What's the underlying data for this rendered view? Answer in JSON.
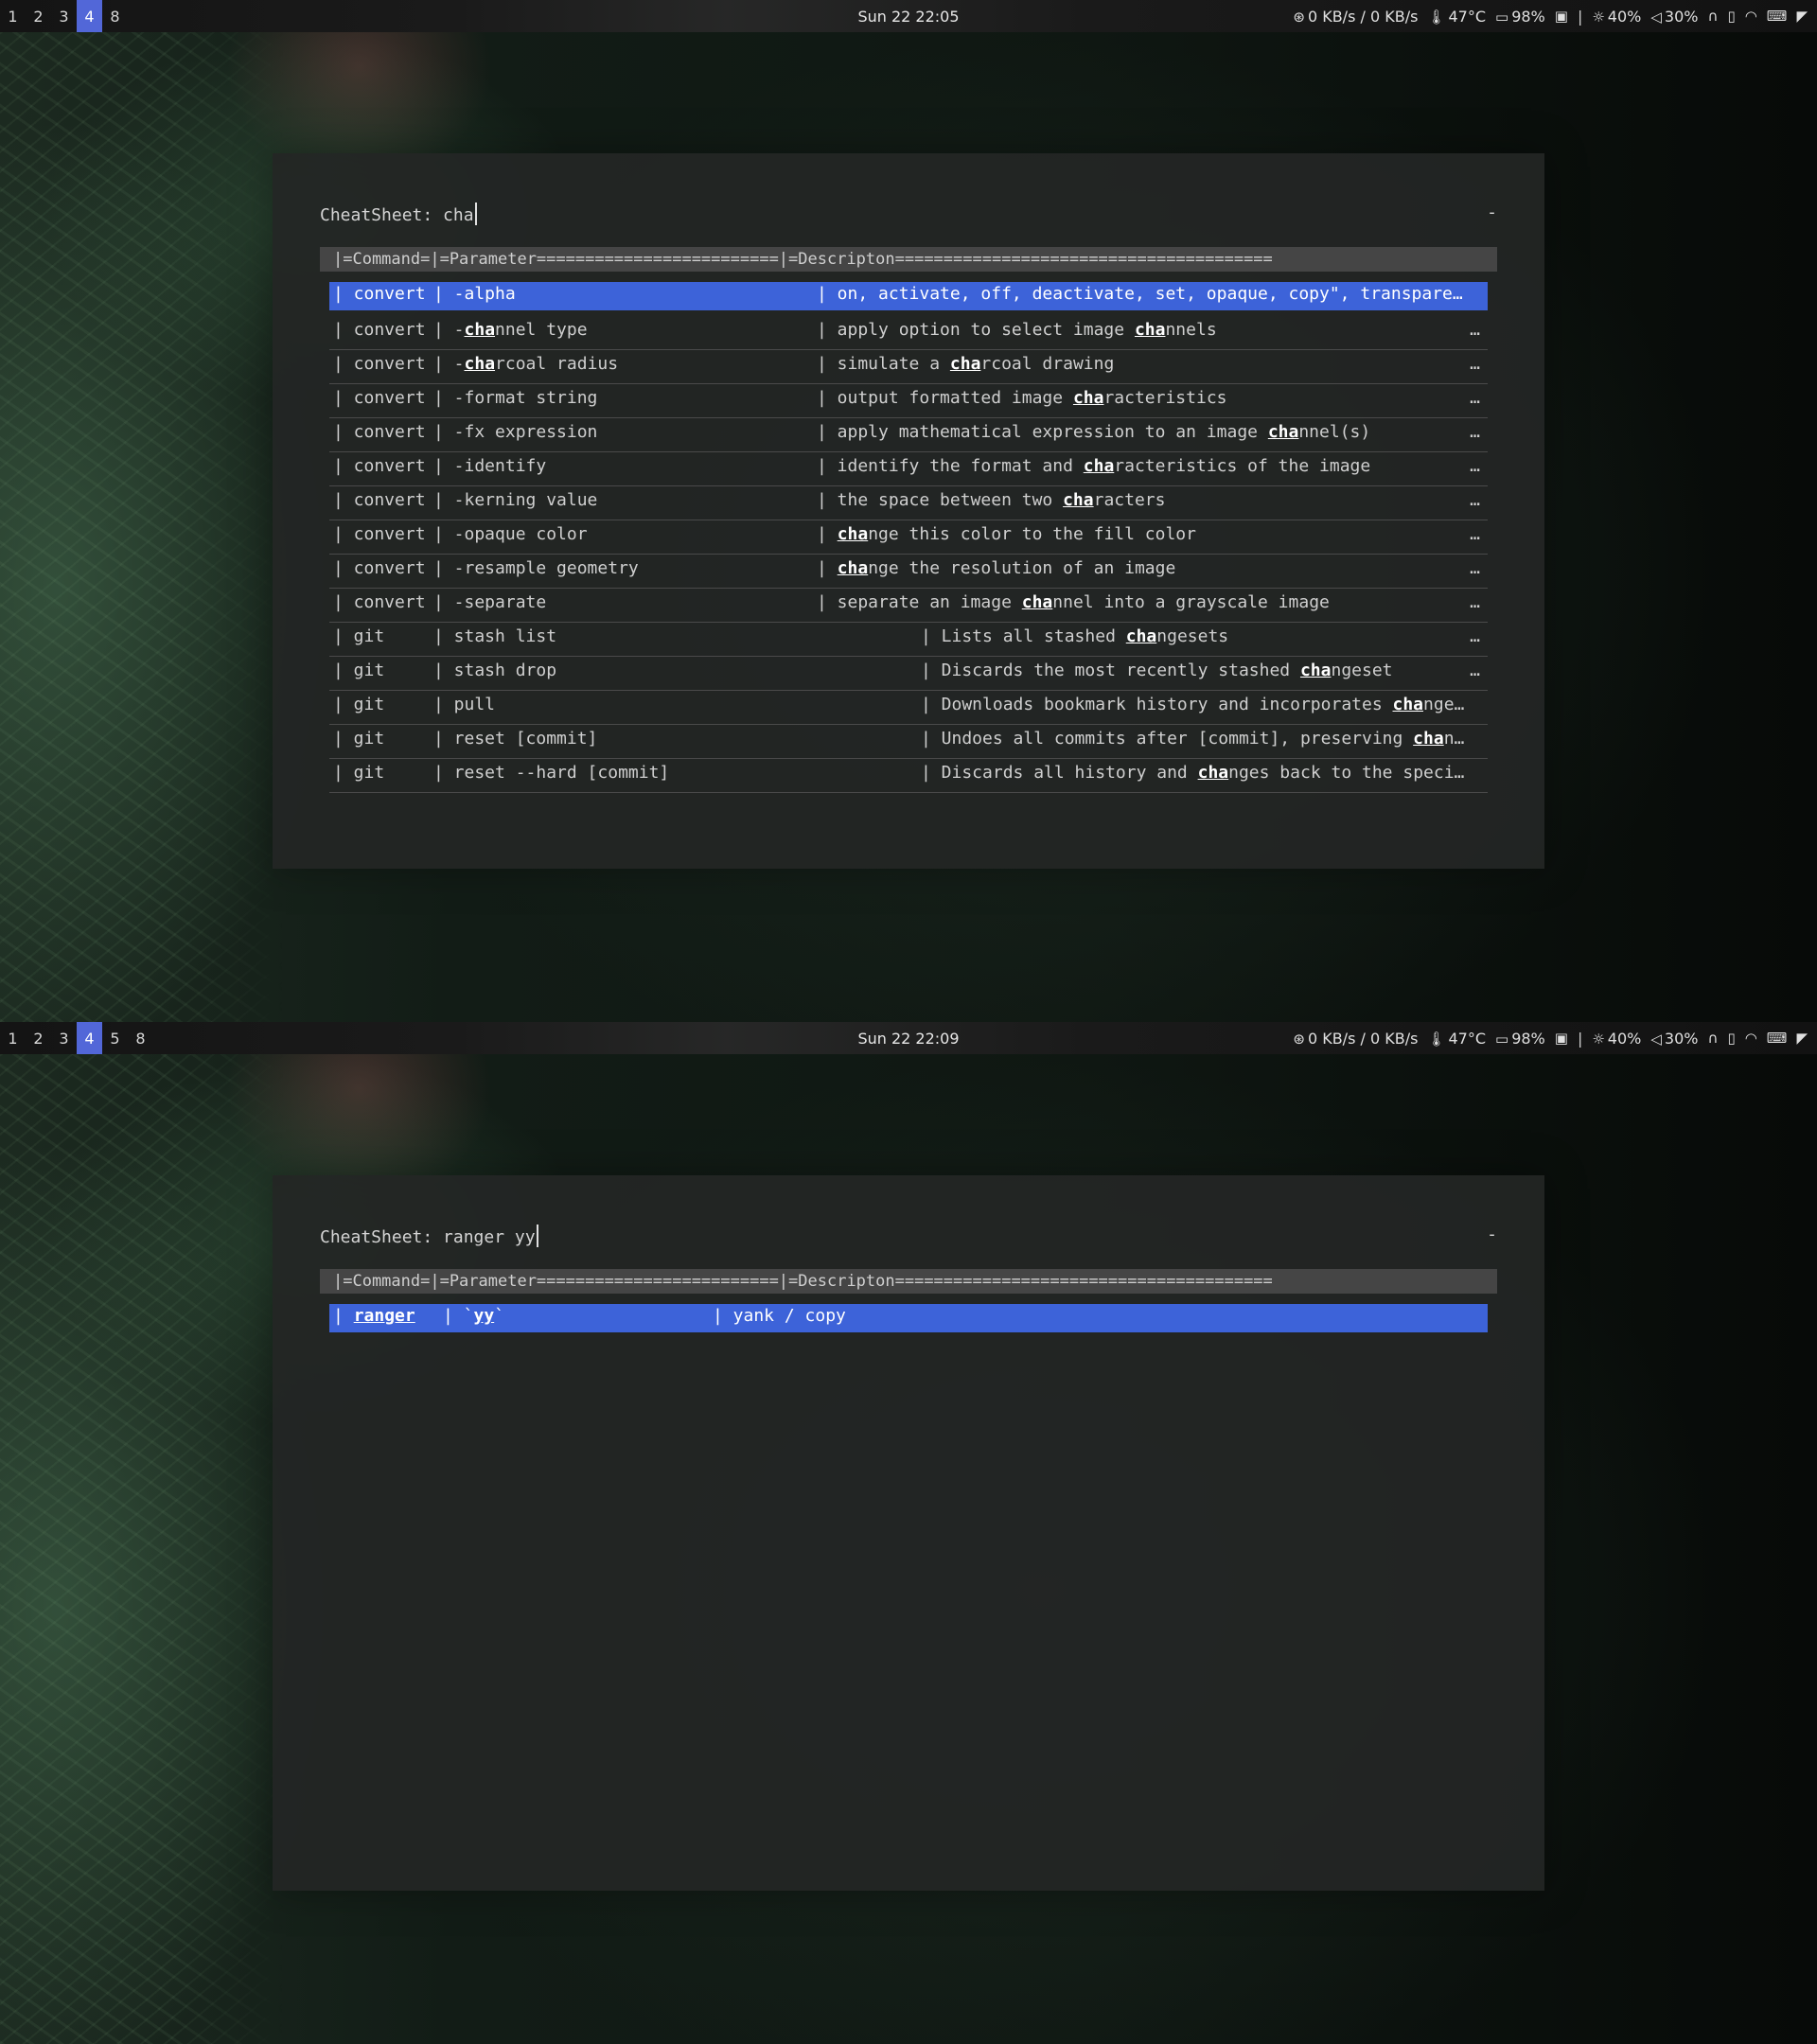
{
  "screens": [
    {
      "workspaces": [
        "1",
        "2",
        "3",
        "4",
        "8"
      ],
      "active_workspace": "4",
      "clock": "Sun 22 22:05",
      "status": {
        "net": "0 KB/s / 0 KB/s",
        "temp": "47°C",
        "battery": "98%",
        "separator": "|",
        "brightness": "40%",
        "volume": "30%"
      },
      "prompt_label": "CheatSheet: ",
      "query": "cha",
      "dash": "-",
      "header": "|=Command=|=Parameter=========================|=Descripton=======================================",
      "rows": [
        {
          "cmd": "| convert",
          "param": "| -alpha",
          "desc": "| on, activate, off, deactivate, set, opaque, copy\", transpare…",
          "selected": true
        },
        {
          "cmd": "| convert",
          "param": "| -channel type",
          "desc": "| apply option to select image channels",
          "ell": "…"
        },
        {
          "cmd": "| convert",
          "param": "| -charcoal radius",
          "desc": "| simulate a charcoal drawing",
          "ell": "…"
        },
        {
          "cmd": "| convert",
          "param": "| -format string",
          "desc": "| output formatted image characteristics",
          "ell": "…"
        },
        {
          "cmd": "| convert",
          "param": "| -fx expression",
          "desc": "| apply mathematical expression to an image channel(s)",
          "ell": "…"
        },
        {
          "cmd": "| convert",
          "param": "| -identify",
          "desc": "| identify the format and characteristics of the image",
          "ell": "…"
        },
        {
          "cmd": "| convert",
          "param": "| -kerning value",
          "desc": "| the space between two characters",
          "ell": "…"
        },
        {
          "cmd": "| convert",
          "param": "| -opaque color",
          "desc": "| change this color to the fill color",
          "ell": "…"
        },
        {
          "cmd": "| convert",
          "param": "| -resample geometry",
          "desc": "| change the resolution of an image",
          "ell": "…"
        },
        {
          "cmd": "| convert",
          "param": "| -separate",
          "desc": "| separate an image channel into a grayscale image",
          "ell": "…"
        },
        {
          "cmd": "| git",
          "param": "| stash list",
          "desc": "| Lists all stashed changesets",
          "ell": "…",
          "wide": true
        },
        {
          "cmd": "| git",
          "param": "| stash drop",
          "desc": "| Discards the most recently stashed changeset",
          "ell": "…",
          "wide": true
        },
        {
          "cmd": "| git",
          "param": "| pull",
          "desc": "| Downloads bookmark history and incorporates change…",
          "wide": true
        },
        {
          "cmd": "| git",
          "param": "| reset [commit]",
          "desc": "| Undoes all commits after [commit], preserving chan…",
          "wide": true
        },
        {
          "cmd": "| git",
          "param": "| reset --hard [commit]",
          "desc": "| Discards all history and changes back to the speci…",
          "wide": true
        }
      ]
    },
    {
      "workspaces": [
        "1",
        "2",
        "3",
        "4",
        "5",
        "8"
      ],
      "active_workspace": "4",
      "clock": "Sun 22 22:09",
      "status": {
        "net": "0 KB/s / 0 KB/s",
        "temp": "47°C",
        "battery": "98%",
        "separator": "|",
        "brightness": "40%",
        "volume": "30%"
      },
      "prompt_label": "CheatSheet: ",
      "query": "ranger yy",
      "dash": "-",
      "header": "|=Command=|=Parameter=========================|=Descripton=======================================",
      "rows": [
        {
          "cmd": "| ranger",
          "param": "| `yy`",
          "desc": "| yank / copy",
          "selected": true,
          "narrow": true
        }
      ]
    }
  ],
  "icons": {
    "net": "network-icon",
    "temp": "thermometer-icon",
    "battery": "battery-charging-icon",
    "brightness": "brightness-icon",
    "volume": "volume-icon"
  }
}
